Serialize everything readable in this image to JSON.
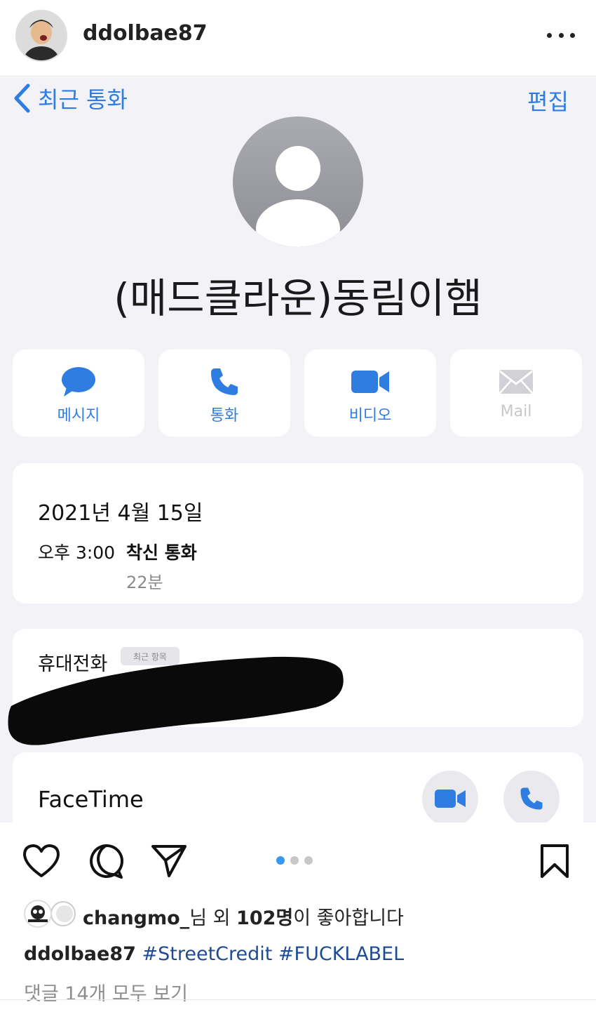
{
  "header": {
    "username": "ddolbae87"
  },
  "screenshot": {
    "back_label": "최근 통화",
    "edit_label": "편집",
    "contact_name": "(매드클라운)동림이햄",
    "actions": [
      {
        "label": "메시지",
        "icon": "message-bubble-icon"
      },
      {
        "label": "통화",
        "icon": "phone-icon"
      },
      {
        "label": "비디오",
        "icon": "video-camera-icon"
      },
      {
        "label": "Mail",
        "icon": "mail-envelope-icon"
      }
    ],
    "call_log": {
      "date": "2021년 4월 15일",
      "time": "오후 3:00",
      "type": "착신 통화",
      "duration": "22분"
    },
    "phone": {
      "label": "휴대전화",
      "badge": "최근 항목"
    },
    "facetime_label": "FaceTime",
    "accent_color": "#2f7de0"
  },
  "footer": {
    "likes": {
      "user": "changmo_",
      "middle": "님 외 ",
      "count": "102명",
      "suffix": "이 좋아합니다"
    },
    "caption": {
      "user": "ddolbae87",
      "tags": "#StreetCredit #FUCKLABEL"
    },
    "comments_link": "댓글 14개 모두 보기",
    "carousel": {
      "count": 3,
      "active": 1
    }
  }
}
